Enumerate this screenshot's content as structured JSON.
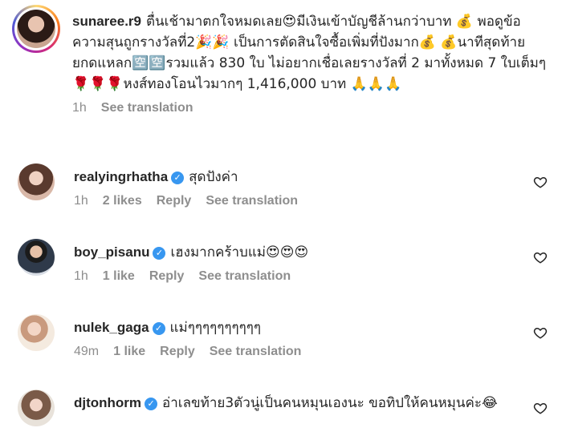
{
  "caption": {
    "username": "sunaree.r9",
    "text": "ตื่นเช้ามาตกใจหมดเลย😍มีเงินเข้าบัญชีล้านกว่าบาท 💰 พอดูข้อความสุนถูกรางวัลที่2🎉🎉 เป็นการตัดสินใจซื้อเพิ่มที่ปังมาก💰 💰นาทีสุดท้ายยกดแหลก🈳🈳รวมแล้ว 830 ใบ ไม่อยากเชื่อเลยรางวัลที่ 2 มาทั้งหมด 7 ใบเต็มๆ🌹🌹🌹หงส์ทองโอนไวมากๆ 1,416,000 บาท 🙏🙏🙏",
    "time": "1h",
    "see_translation": "See translation"
  },
  "comments": [
    {
      "username": "realyingrhatha",
      "text": "สุดปังค่า",
      "time": "1h",
      "likes": "2 likes",
      "reply": "Reply",
      "see_translation": "See translation"
    },
    {
      "username": "boy_pisanu",
      "text": "เฮงมากคร้าบแม่😍😍😍",
      "time": "1h",
      "likes": "1 like",
      "reply": "Reply",
      "see_translation": "See translation"
    },
    {
      "username": "nulek_gaga",
      "text": "แม่ๆๆๆๆๆๆๆๆๆๆ",
      "time": "49m",
      "likes": "1 like",
      "reply": "Reply",
      "see_translation": "See translation"
    },
    {
      "username": "djtonhorm",
      "text": "อ่าเลขท้าย3ตัวนู่เป็นคนหมุนเองนะ ขอทิปให้คนหมุนค่ะ😂",
      "time": "",
      "likes": "",
      "reply": "",
      "see_translation": ""
    }
  ],
  "icons": {
    "verified": "verified-badge-icon",
    "like": "heart-outline-icon"
  },
  "colors": {
    "verified": "#3897f0",
    "meta": "#8e8e8e",
    "text": "#262626"
  }
}
